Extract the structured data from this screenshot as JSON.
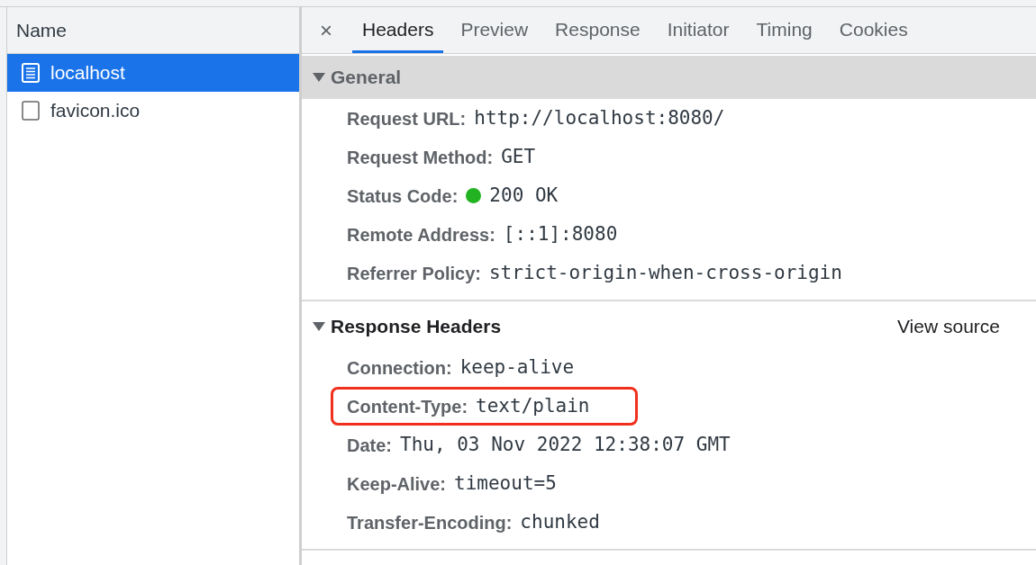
{
  "request_list": {
    "header": "Name",
    "items": [
      {
        "label": "localhost",
        "kind": "document",
        "selected": true
      },
      {
        "label": "favicon.ico",
        "kind": "other",
        "selected": false
      }
    ]
  },
  "close_button": "×",
  "tabs": [
    {
      "label": "Headers",
      "selected": true
    },
    {
      "label": "Preview",
      "selected": false
    },
    {
      "label": "Response",
      "selected": false
    },
    {
      "label": "Initiator",
      "selected": false
    },
    {
      "label": "Timing",
      "selected": false
    },
    {
      "label": "Cookies",
      "selected": false
    }
  ],
  "sections": [
    {
      "title": "General",
      "expanded": true,
      "kind": "shaded",
      "rows": [
        {
          "name": "Request URL:",
          "value": "http://localhost:8080/"
        },
        {
          "name": "Request Method:",
          "value": "GET"
        },
        {
          "name": "Status Code:",
          "value": "200 OK",
          "color": "#22b322"
        },
        {
          "name": "Remote Address:",
          "value": "[::1]:8080"
        },
        {
          "name": "Referrer Policy:",
          "value": "strict-origin-when-cross-origin"
        }
      ]
    },
    {
      "title": "Response Headers",
      "expanded": true,
      "kind": "plain",
      "action": "View source",
      "rows": [
        {
          "name": "Connection:",
          "value": "keep-alive"
        },
        {
          "name": "Content-Type:",
          "value": "text/plain",
          "highlighted": true
        },
        {
          "name": "Date:",
          "value": "Thu, 03 Nov 2022 12:38:07 GMT"
        },
        {
          "name": "Keep-Alive:",
          "value": "timeout=5"
        },
        {
          "name": "Transfer-Encoding:",
          "value": "chunked"
        }
      ]
    }
  ]
}
